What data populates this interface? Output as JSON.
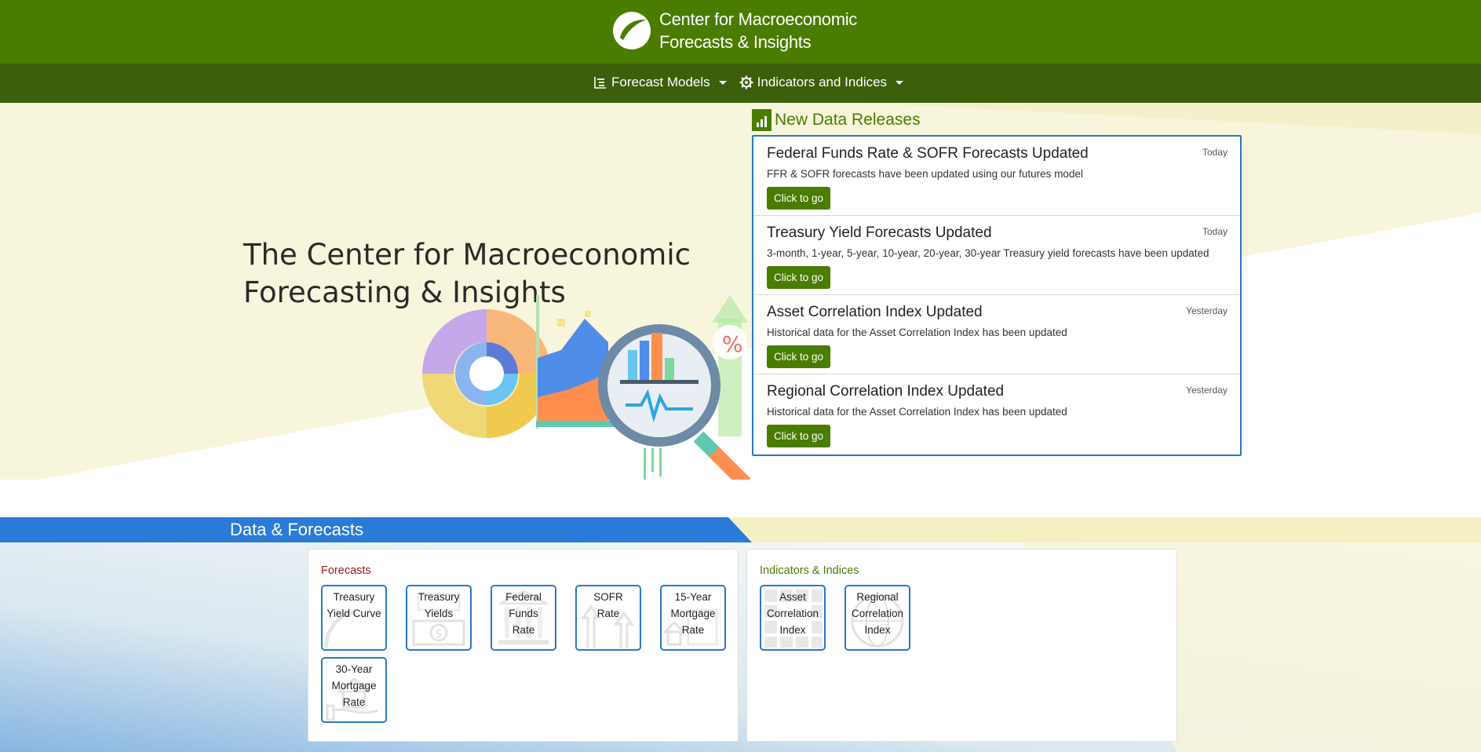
{
  "header": {
    "brand_line1": "Center for Macroeconomic",
    "brand_line2": "Forecasts & Insights"
  },
  "nav": {
    "items": [
      {
        "label": "Forecast Models",
        "icon": "list-tree-icon"
      },
      {
        "label": "Indicators and Indices",
        "icon": "gear-icon"
      }
    ]
  },
  "hero": {
    "title_line1": "The Center for Macroeconomic",
    "title_line2": "Forecasting & Insights"
  },
  "releases": {
    "title": "New Data Releases",
    "icon": "bar-chart-icon",
    "items": [
      {
        "title": "Federal Funds Rate & SOFR Forecasts Updated",
        "date": "Today",
        "desc": "FFR & SOFR forecasts have been updated using our futures model",
        "button": "Click to go"
      },
      {
        "title": "Treasury Yield Forecasts Updated",
        "date": "Today",
        "desc": "3-month, 1-year, 5-year, 10-year, 20-year, 30-year Treasury yield forecasts have been updated",
        "button": "Click to go"
      },
      {
        "title": "Asset Correlation Index Updated",
        "date": "Yesterday",
        "desc": "Historical data for the Asset Correlation Index has been updated",
        "button": "Click to go"
      },
      {
        "title": "Regional Correlation Index Updated",
        "date": "Yesterday",
        "desc": "Historical data for the Asset Correlation Index has been updated",
        "button": "Click to go"
      }
    ]
  },
  "data_forecasts": {
    "title": "Data & Forecasts",
    "forecasts": {
      "label": "Forecasts",
      "tiles": [
        {
          "l1": "Treasury",
          "l2": "Yield Curve",
          "l3": "",
          "icon": "curve-icon"
        },
        {
          "l1": "Treasury",
          "l2": "Yields",
          "l3": "",
          "icon": "dollar-bill-icon"
        },
        {
          "l1": "Federal",
          "l2": "Funds",
          "l3": "Rate",
          "icon": "bank-icon"
        },
        {
          "l1": "SOFR",
          "l2": "Rate",
          "l3": "",
          "icon": "up-arrows-icon"
        },
        {
          "l1": "15-Year",
          "l2": "Mortgage",
          "l3": "Rate",
          "icon": "house-document-icon"
        },
        {
          "l1": "30-Year",
          "l2": "Mortgage",
          "l3": "Rate",
          "icon": "house-hand-icon"
        }
      ]
    },
    "indicators": {
      "label": "Indicators & Indices",
      "tiles": [
        {
          "l1": "Asset",
          "l2": "Correlation",
          "l3": "Index",
          "icon": "grid-icon"
        },
        {
          "l1": "Regional",
          "l2": "Correlation",
          "l3": "Index",
          "icon": "globe-icon"
        }
      ]
    }
  },
  "colors": {
    "header_green": "#4a7c00",
    "nav_green": "#3b5f0b",
    "accent_blue": "#2a77c9",
    "forecast_red": "#a11a1a"
  }
}
